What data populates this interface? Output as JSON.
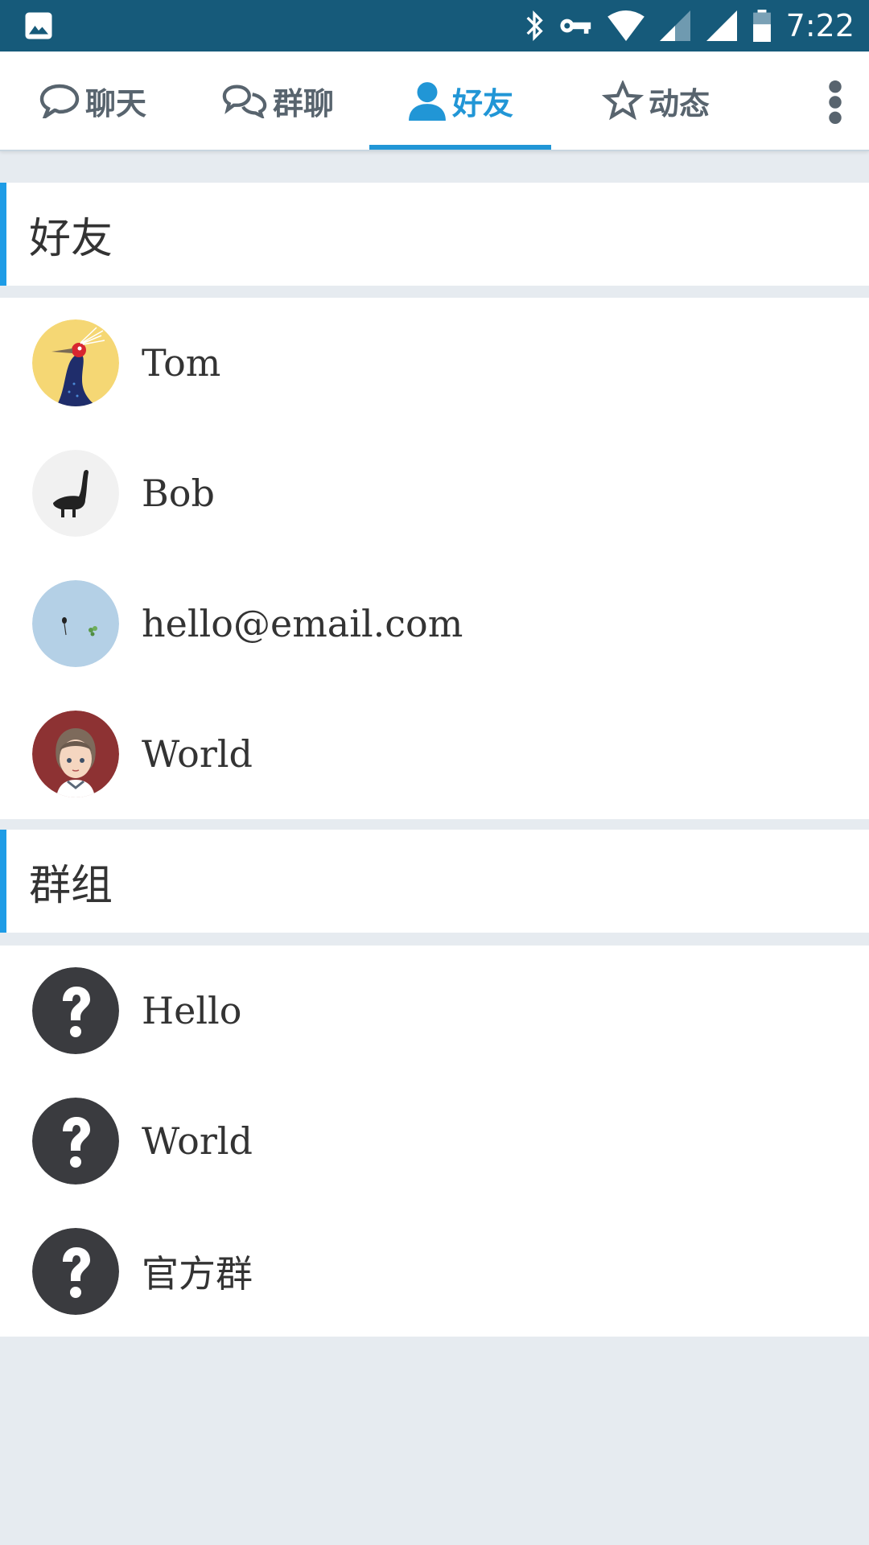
{
  "status_bar": {
    "time": "7:22",
    "icons": [
      "image-icon",
      "bluetooth-icon",
      "vpn-key-icon",
      "wifi-icon",
      "signal-icon",
      "signal-icon",
      "battery-icon"
    ]
  },
  "tabs": [
    {
      "label": "聊天",
      "icon": "chat-bubble-icon",
      "active": false
    },
    {
      "label": "群聊",
      "icon": "group-chat-icon",
      "active": false
    },
    {
      "label": "好友",
      "icon": "person-icon",
      "active": true
    },
    {
      "label": "动态",
      "icon": "star-icon",
      "active": false
    }
  ],
  "overflow_menu_icon": "more-vert-icon",
  "friends_section": {
    "title": "好友",
    "items": [
      {
        "name": "Tom",
        "avatar": "bird-avatar"
      },
      {
        "name": "Bob",
        "avatar": "dinosaur-avatar"
      },
      {
        "name": "hello@email.com",
        "avatar": "sky-avatar"
      },
      {
        "name": "World",
        "avatar": "girl-avatar"
      }
    ]
  },
  "groups_section": {
    "title": "群组",
    "items": [
      {
        "name": "Hello",
        "avatar": "question-icon"
      },
      {
        "name": "World",
        "avatar": "question-icon"
      },
      {
        "name": "官方群",
        "avatar": "question-icon"
      }
    ]
  },
  "colors": {
    "status_bar": "#165a7a",
    "accent": "#2196d6",
    "section_indicator": "#1e9ce6",
    "background": "#e6ebf0"
  }
}
